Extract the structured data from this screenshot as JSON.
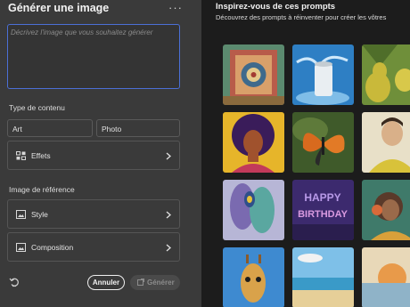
{
  "left_panel": {
    "title": "Générer une image",
    "more_label": "···",
    "prompt": {
      "placeholder": "Décrivez l'image que vous souhaitez générer",
      "value": ""
    },
    "content_type": {
      "label": "Type de contenu",
      "options": [
        "Art",
        "Photo"
      ],
      "effects_label": "Effets"
    },
    "reference": {
      "label": "Image de référence",
      "style_label": "Style",
      "composition_label": "Composition"
    },
    "footer": {
      "cancel_label": "Annuler",
      "generate_label": "Générer"
    }
  },
  "right_panel": {
    "title": "Inspirez-vous de ces prompts",
    "subtitle": "Découvrez des prompts à réinventer pour créer les vôtres",
    "gallery": [
      {
        "name": "gallery-tile-textile-pattern"
      },
      {
        "name": "gallery-tile-water-can"
      },
      {
        "name": "gallery-tile-pears"
      },
      {
        "name": "gallery-tile-afro-woman"
      },
      {
        "name": "gallery-tile-butterfly"
      },
      {
        "name": "gallery-tile-man-portrait"
      },
      {
        "name": "gallery-tile-peacock-feathers"
      },
      {
        "name": "gallery-tile-happy-birthday"
      },
      {
        "name": "gallery-tile-headphones-girl"
      },
      {
        "name": "gallery-tile-giraffe"
      },
      {
        "name": "gallery-tile-beach"
      },
      {
        "name": "gallery-tile-sunset-arch"
      }
    ]
  },
  "colors": {
    "panel_bg": "#3a3a3a",
    "gallery_bg": "#1c1c1c",
    "focus_border": "#4b6fd6"
  }
}
